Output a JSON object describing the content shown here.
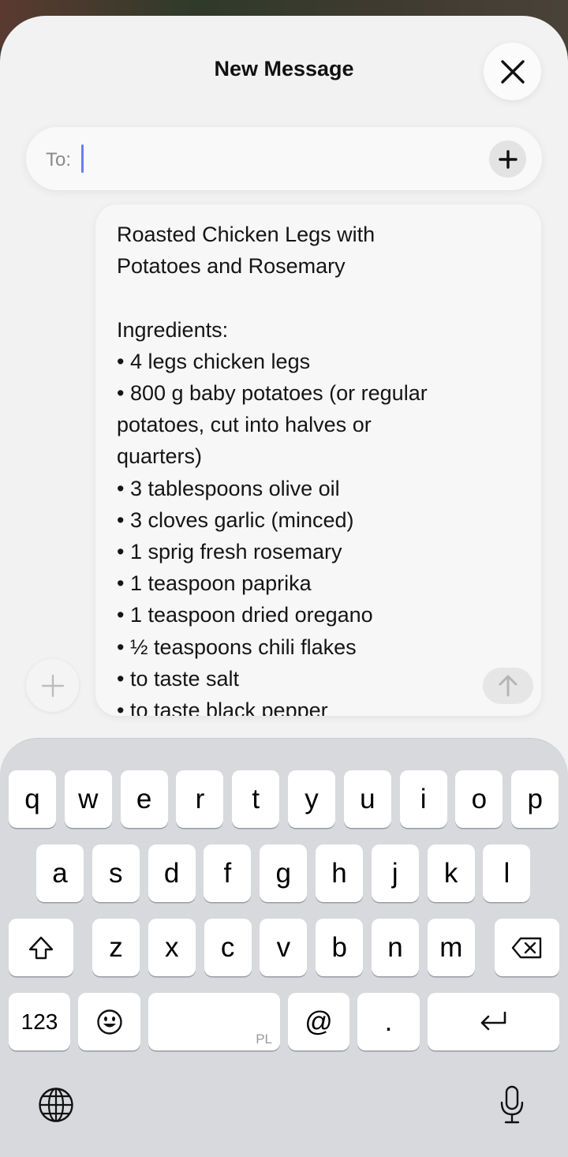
{
  "header": {
    "title": "New Message"
  },
  "to_field": {
    "label": "To:",
    "value": ""
  },
  "message": {
    "lines": [
      "Roasted Chicken Legs with",
      "Potatoes and Rosemary",
      "",
      "Ingredients:",
      "• 4 legs chicken legs",
      "• 800 g baby potatoes (or regular",
      "potatoes, cut into halves or",
      "quarters)",
      "• 3 tablespoons olive oil",
      "• 3 cloves garlic (minced)",
      "• 1 sprig fresh rosemary",
      "• 1 teaspoon paprika",
      "• 1 teaspoon dried oregano",
      "• ½ teaspoons chili flakes",
      "• to taste salt",
      "• to taste black pepper"
    ]
  },
  "keyboard": {
    "row1": [
      "q",
      "w",
      "e",
      "r",
      "t",
      "y",
      "u",
      "i",
      "o",
      "p"
    ],
    "row2": [
      "a",
      "s",
      "d",
      "f",
      "g",
      "h",
      "j",
      "k",
      "l"
    ],
    "row3": [
      "z",
      "x",
      "c",
      "v",
      "b",
      "n",
      "m"
    ],
    "numbers_label": "123",
    "space_language": "PL",
    "at_label": "@",
    "period_label": "."
  },
  "icons": {
    "close": "close-icon",
    "add_recipient": "plus-icon",
    "attach": "plus-icon",
    "send": "arrow-up-icon",
    "shift": "shift-icon",
    "delete": "backspace-icon",
    "emoji": "emoji-icon",
    "return": "return-icon",
    "globe": "globe-icon",
    "mic": "microphone-icon"
  },
  "colors": {
    "caret": "#6a7ff0",
    "keyboard_bg": "#d8d9dd",
    "sheet_bg": "#f2f2f2"
  }
}
